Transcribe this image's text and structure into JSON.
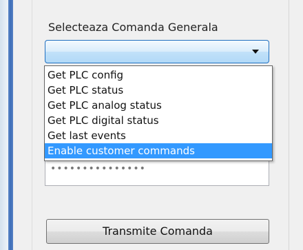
{
  "command_group": {
    "label": "Selecteaza Comanda Generala",
    "selected_value": ""
  },
  "dropdown": {
    "items": [
      {
        "label": "Get PLC config",
        "selected": false
      },
      {
        "label": "Get PLC status",
        "selected": false
      },
      {
        "label": "Get PLC analog status",
        "selected": false
      },
      {
        "label": "Get PLC digital status",
        "selected": false
      },
      {
        "label": "Get last events",
        "selected": false
      },
      {
        "label": "Enable customer commands",
        "selected": true
      }
    ]
  },
  "password_field": {
    "masked_value": "•••••••••••••••"
  },
  "transmit_button": {
    "label": "Transmite Comanda"
  },
  "colors": {
    "accent_bar": "#3c6db8",
    "selection": "#3399ff",
    "combo_border": "#1f6fc0"
  }
}
